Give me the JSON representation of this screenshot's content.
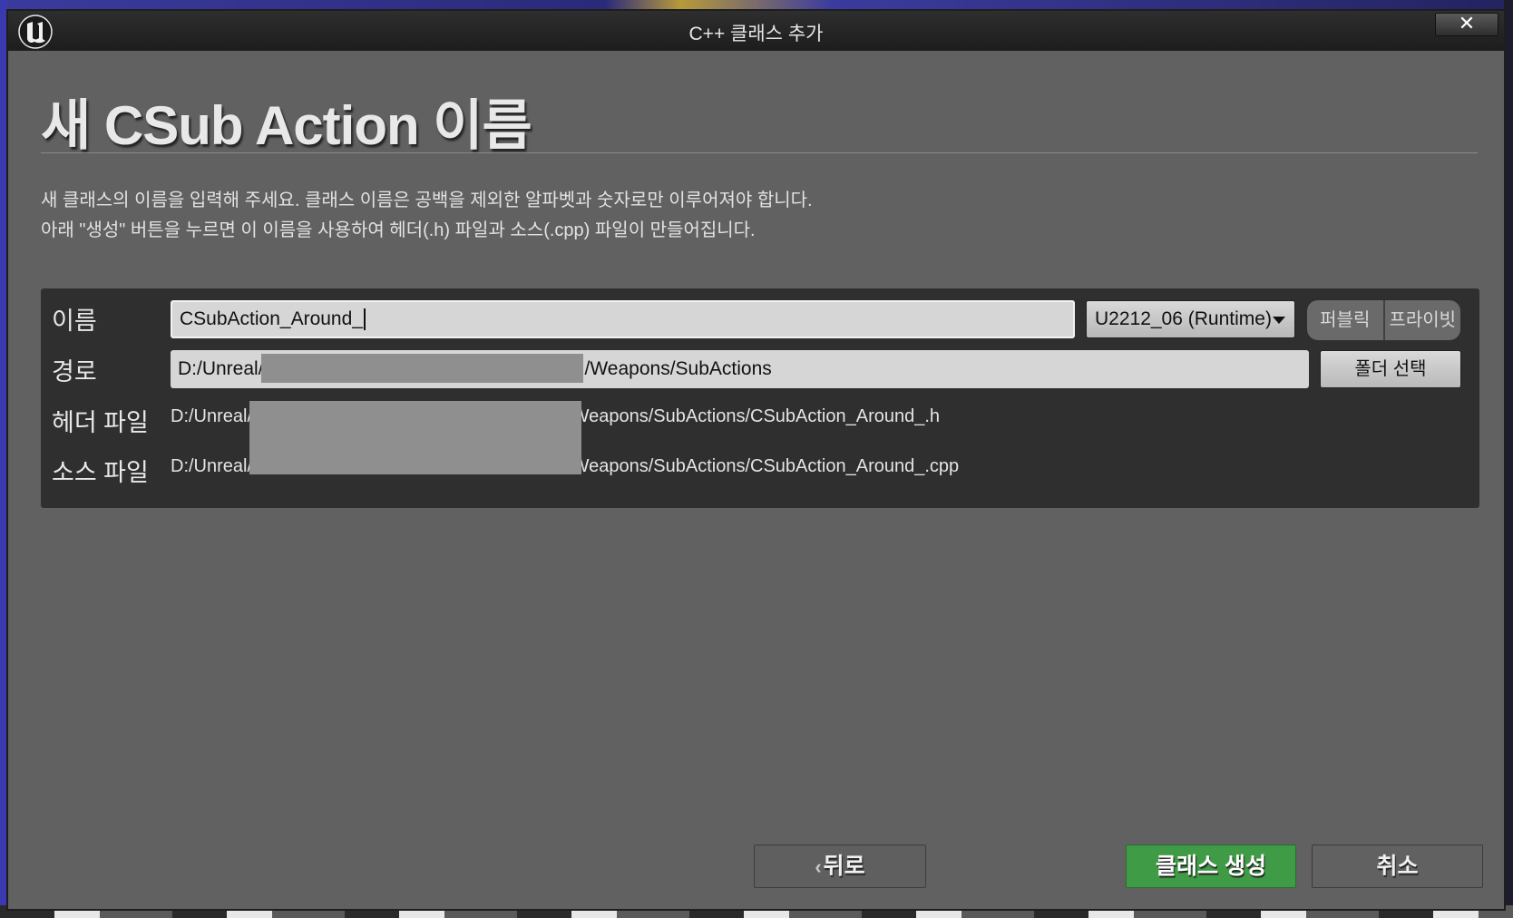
{
  "window": {
    "title": "C++ 클래스 추가",
    "close_glyph": "✕"
  },
  "heading": "새 CSub Action 이름",
  "description": {
    "line1": "새 클래스의 이름을 입력해 주세요. 클래스 이름은 공백을 제외한 알파벳과 숫자로만 이루어져야 합니다.",
    "line2": "아래 \"생성\" 버튼을 누르면 이 이름을 사용하여 헤더(.h) 파일과 소스(.cpp) 파일이 만들어집니다."
  },
  "form": {
    "name_label": "이름",
    "name_value": "CSubAction_Around_",
    "module_selected": "U2212_06 (Runtime)",
    "access": {
      "public_label": "퍼블릭",
      "private_label": "프라이빗"
    },
    "path_label": "경로",
    "path_prefix": "D:/Unreal/",
    "path_suffix": "/Weapons/SubActions",
    "folder_button": "폴더 선택",
    "header_label": "헤더 파일",
    "header_prefix": "D:/Unreal/",
    "header_suffix": "/Weapons/SubActions/CSubAction_Around_.h",
    "source_label": "소스 파일",
    "source_prefix": "D:/Unreal/",
    "source_suffix": "/Weapons/SubActions/CSubAction_Around_.cpp"
  },
  "buttons": {
    "back": "뒤로",
    "create": "클래스 생성",
    "cancel": "취소"
  },
  "colors": {
    "dialog_bg": "#616161",
    "panel_bg": "#2f2f2f",
    "create_button": "#3f9b45"
  }
}
